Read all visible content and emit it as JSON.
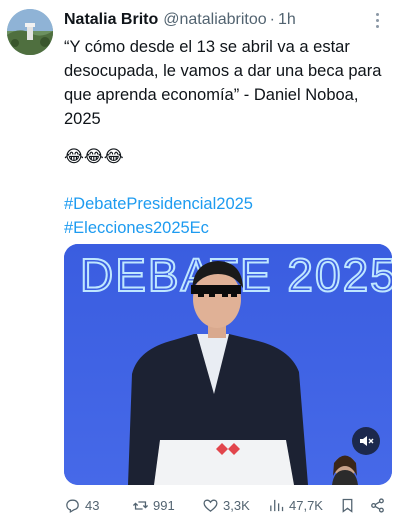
{
  "tweet": {
    "author_name": "Natalia Brito",
    "handle": "@nataliabritoo",
    "separator": "·",
    "time": "1h",
    "text": "“Y cómo desde el 13 se abril va a estar desocupada, le vamos a dar una beca para que aprenda economía” - Daniel Noboa, 2025",
    "emojis": "😂😂😂",
    "hashtags": [
      "#DebatePresidencial2025",
      "#Elecciones2025Ec"
    ]
  },
  "media": {
    "backdrop_text": "DEBATE 2025",
    "icons": {
      "mute": "volume-muted-icon"
    }
  },
  "actions": {
    "replies": "43",
    "reposts": "991",
    "likes": "3,3K",
    "views": "47,7K"
  },
  "colors": {
    "link": "#1d9bf0",
    "muted_text": "#536471",
    "backdrop_blue": "#3d5fe0"
  }
}
